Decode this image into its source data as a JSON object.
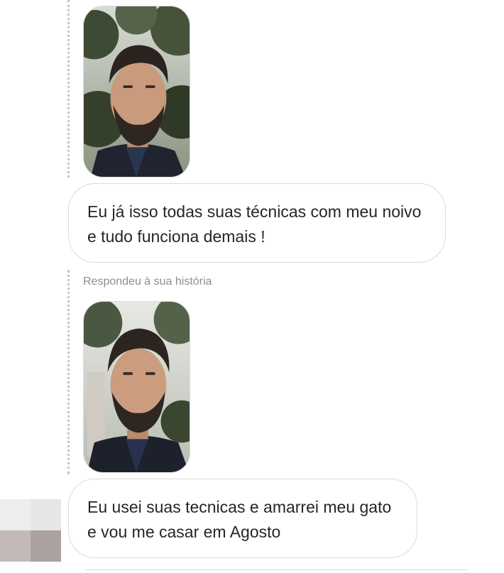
{
  "conversation": {
    "messages": [
      {
        "type": "story_reply",
        "story_label": "",
        "text": "Eu já isso todas suas técnicas com meu noivo e tudo funciona demais !"
      },
      {
        "type": "story_reply",
        "story_label": "Respondeu à sua história",
        "text": "Eu usei suas tecnicas e amarrei meu gato e vou me casar em Agosto"
      }
    ]
  },
  "colors": {
    "bubble_border": "#dbdbdb",
    "label_gray": "#8e8e8e",
    "text": "#262626",
    "dotted_line": "#c7c7c7"
  }
}
